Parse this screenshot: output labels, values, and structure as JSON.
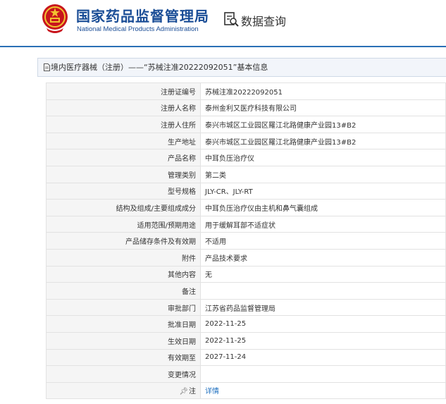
{
  "header": {
    "title_cn": "国家药品监督管理局",
    "title_en": "National Medical Products Administration",
    "search_title": "数据查询",
    "emblem_icon": "national-emblem-icon",
    "brand_color": "#1a4d96",
    "accent_color": "#c8151d"
  },
  "panel": {
    "title": "境内医疗器械（注册）——“苏械注准20222092051”基本信息"
  },
  "rows": [
    {
      "label": "注册证编号",
      "value": "苏械注准20222092051"
    },
    {
      "label": "注册人名称",
      "value": "泰州金利又医疗科技有限公司"
    },
    {
      "label": "注册人住所",
      "value": "泰兴市城区工业园区羅江北路健康产业园13#B2"
    },
    {
      "label": "生产地址",
      "value": "泰兴市城区工业园区羅江北路健康产业园13#B2"
    },
    {
      "label": "产品名称",
      "value": "中耳负压治疗仪"
    },
    {
      "label": "管理类别",
      "value": "第二类"
    },
    {
      "label": "型号规格",
      "value": "JLY-CR、JLY-RT"
    },
    {
      "label": "结构及组成/主要组成成分",
      "value": "中耳负压治疗仪由主机和鼻气囊组成"
    },
    {
      "label": "适用范围/预期用途",
      "value": "用于缓解耳部不适症状"
    },
    {
      "label": "产品储存条件及有效期",
      "value": "不适用"
    },
    {
      "label": "附件",
      "value": "产品技术要求"
    },
    {
      "label": "其他内容",
      "value": "无"
    },
    {
      "label": "备注",
      "value": ""
    },
    {
      "label": "审批部门",
      "value": "江苏省药品监督管理局"
    },
    {
      "label": "批准日期",
      "value": "2022-11-25"
    },
    {
      "label": "生效日期",
      "value": "2022-11-25"
    },
    {
      "label": "有效期至",
      "value": "2027-11-24"
    },
    {
      "label": "变更情况",
      "value": ""
    }
  ],
  "note_row": {
    "icon": "pin-icon",
    "label": "注",
    "link": "详情"
  }
}
